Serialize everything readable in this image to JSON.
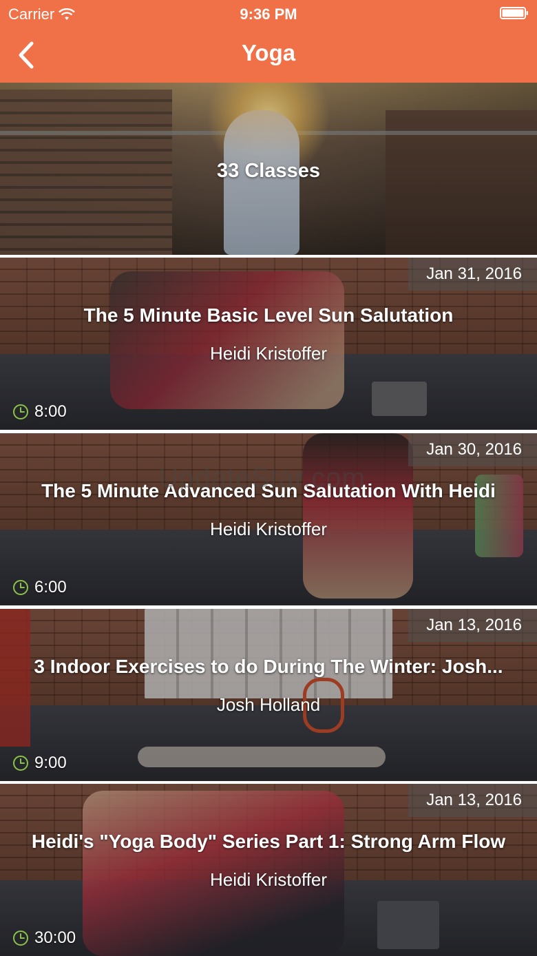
{
  "status_bar": {
    "carrier": "Carrier",
    "time": "9:36 PM"
  },
  "nav": {
    "title": "Yoga",
    "back_icon": "chevron-left-icon"
  },
  "colors": {
    "nav_bar": "#f07047",
    "clock_icon": "#8bc34a"
  },
  "hero": {
    "label": "33 Classes"
  },
  "classes": [
    {
      "date": "Jan 31, 2016",
      "title": "The 5 Minute Basic Level Sun Salutation",
      "author": "Heidi Kristoffer",
      "duration": "8:00"
    },
    {
      "date": "Jan 30, 2016",
      "title": "The 5 Minute Advanced Sun Salutation With Heidi",
      "author": "Heidi Kristoffer",
      "duration": "6:00"
    },
    {
      "date": "Jan 13, 2016",
      "title": "3 Indoor Exercises to do During The Winter: Josh...",
      "author": "Josh Holland",
      "duration": "9:00"
    },
    {
      "date": "Jan 13, 2016",
      "title": "Heidi's \"Yoga Body\" Series Part 1: Strong Arm Flow",
      "author": "Heidi Kristoffer",
      "duration": "30:00"
    }
  ],
  "watermark": "UpdateStar.com"
}
